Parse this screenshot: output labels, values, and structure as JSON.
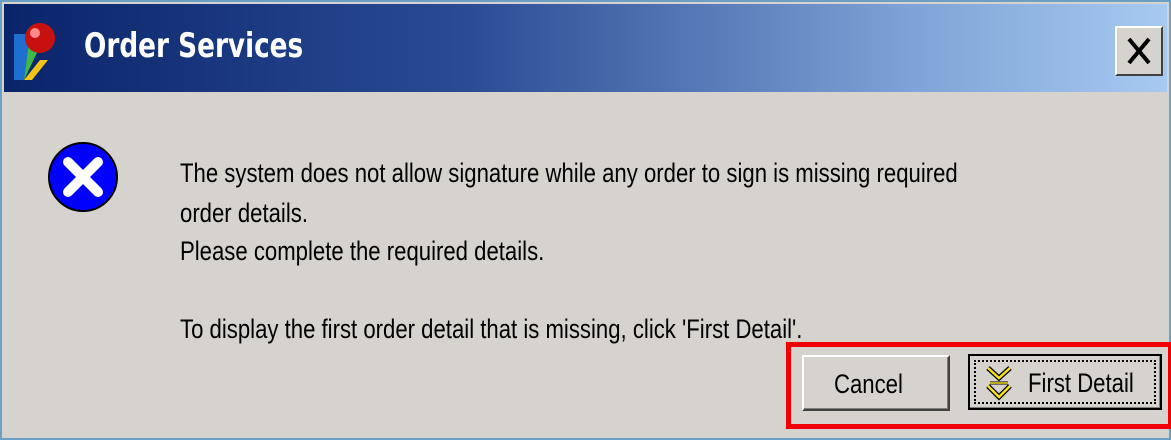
{
  "window": {
    "title": "Order Services"
  },
  "titlebar": {
    "close_label": "X"
  },
  "message": {
    "line1": "The system does not allow signature while any order to sign is missing required",
    "line2": "order details.",
    "line3": "Please complete the required details.",
    "line4": "To display the first order detail that is missing, click 'First Detail'."
  },
  "buttons": {
    "cancel_label": "Cancel",
    "first_detail_label": "First Detail"
  },
  "icons": {
    "app": "app-pin-icon",
    "error": "error-x-icon",
    "first_detail": "double-down-arrow-icon"
  },
  "colors": {
    "titlebar_start": "#0a246a",
    "titlebar_end": "#a6caf0",
    "dialog_face": "#d6d3ce",
    "error_icon": "#0000ff",
    "highlight": "#f00000"
  }
}
